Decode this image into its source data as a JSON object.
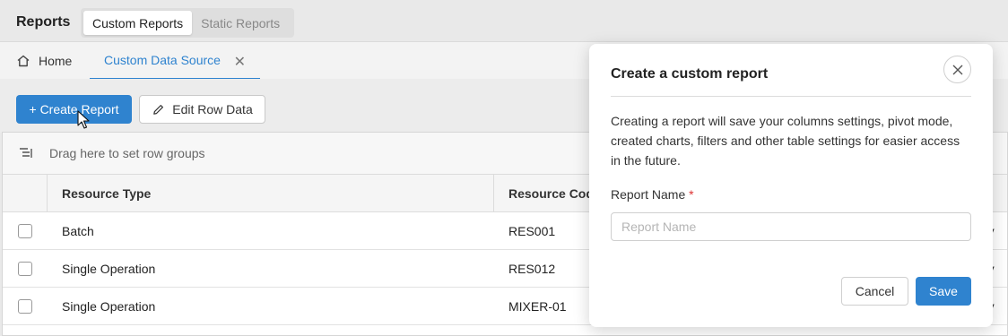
{
  "app": {
    "title": "Reports",
    "segments": [
      "Custom Reports",
      "Static Reports"
    ],
    "active_segment": "Custom Reports"
  },
  "tabs": {
    "home_label": "Home",
    "active_label": "Custom Data Source",
    "close_symbol": "✕"
  },
  "toolbar": {
    "create_label": "+ Create Report",
    "edit_label": "Edit Row Data"
  },
  "grid": {
    "group_placeholder": "Drag here to set row groups",
    "headers": [
      "Resource Type",
      "Resource Code",
      "↑"
    ],
    "rows": [
      {
        "type": "Batch",
        "code": "RES001",
        "cat": "ry"
      },
      {
        "type": "Single Operation",
        "code": "RES012",
        "cat": "ry"
      },
      {
        "type": "Single Operation",
        "code": "MIXER-01",
        "cat": "ry"
      }
    ]
  },
  "modal": {
    "title": "Create a custom report",
    "description": "Creating a report will save your columns settings, pivot mode, created charts, filters and other table settings for easier access in the future.",
    "field_label": "Report Name",
    "required_mark": "*",
    "field_placeholder": "Report Name",
    "field_value": "",
    "cancel_label": "Cancel",
    "save_label": "Save"
  },
  "colors": {
    "accent": "#2f83cf",
    "required": "#d33333"
  },
  "icons": [
    "home-icon",
    "close-icon",
    "pencil-icon",
    "row-group-icon",
    "cursor-icon",
    "sort-asc-icon"
  ]
}
